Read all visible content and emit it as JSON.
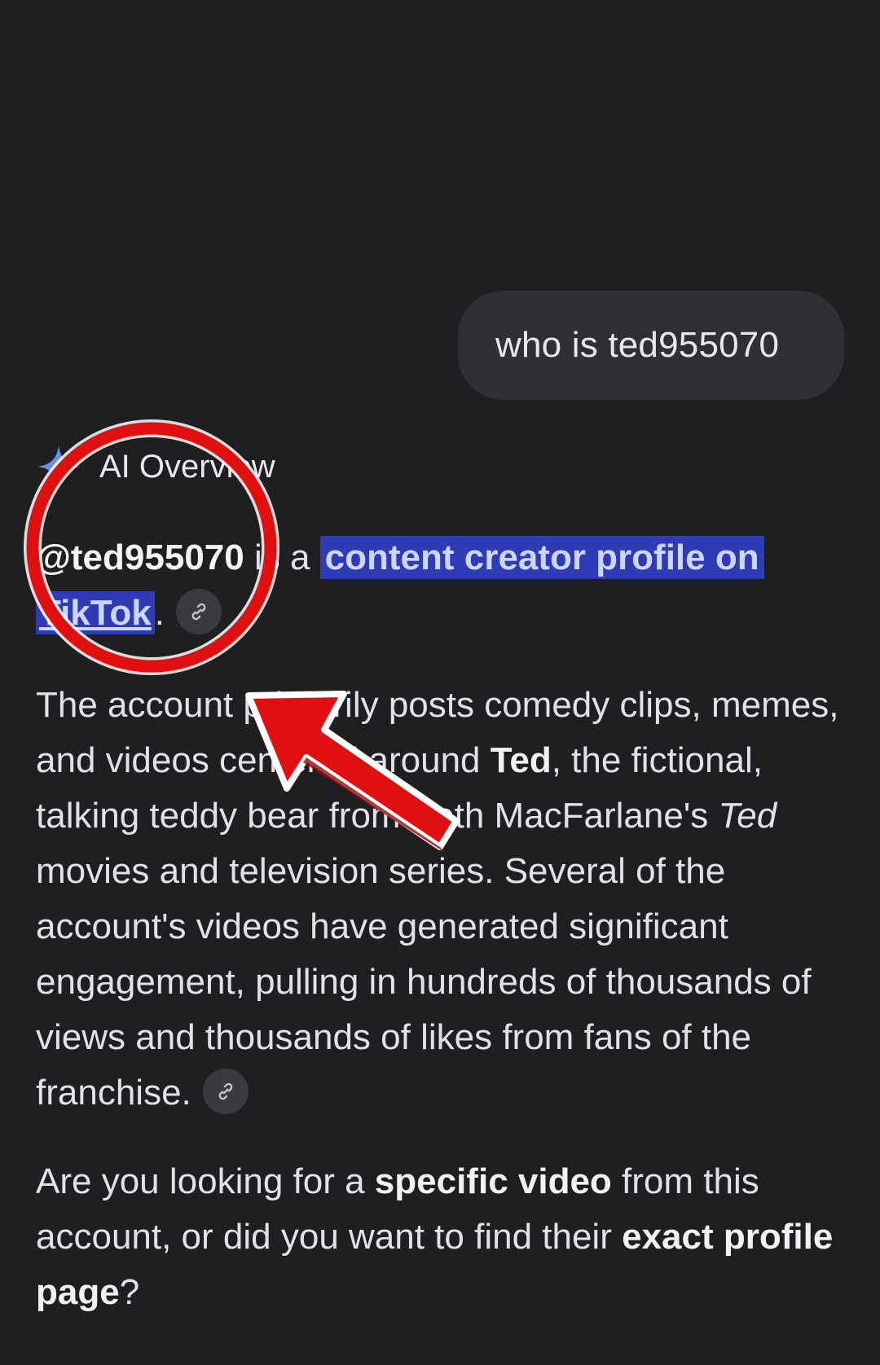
{
  "query": {
    "text": "who is ted955070"
  },
  "ai_overview": {
    "header_label": "AI Overview",
    "p1": {
      "handle": "@ted955070",
      "is_a": " is a ",
      "highlight": "content creator profile on",
      "space": " ",
      "link": "TikTok",
      "period": "."
    },
    "p2": {
      "t1": "The account primarily posts comedy clips, memes, and videos centered around ",
      "b1": "Ted",
      "t2": ", the fictional, talking teddy bear from Seth MacFarlane's ",
      "i1": "Ted",
      "t3": " movies and television series. Several of the account's videos have generated significant engagement, pulling in hundreds of thousands of views and thousands of likes from fans of the franchise."
    },
    "p3": {
      "t1": "Are you looking for a ",
      "b1": "specific video",
      "t2": " from this account, or did you want to find their ",
      "b2": "exact profile page",
      "t3": "?"
    }
  },
  "icons": {
    "sparkle": "sparkle-icon",
    "link": "link-icon"
  },
  "colors": {
    "background": "#1f1f22",
    "bubble": "#2f3035",
    "highlight": "#2e3bb4",
    "annotation_red": "#e01010"
  }
}
